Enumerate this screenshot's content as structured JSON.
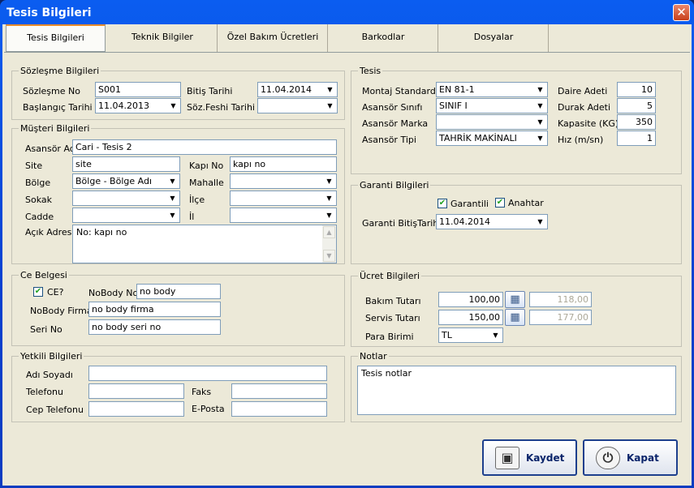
{
  "window": {
    "title": "Tesis Bilgileri",
    "close_glyph": "✕"
  },
  "tabs": [
    "Tesis Bilgileri",
    "Teknik Bilgiler",
    "Özel Bakım Ücretleri",
    "Barkodlar",
    "Dosyalar"
  ],
  "sozlesme": {
    "title": "Sözleşme Bilgileri",
    "no_label": "Sözleşme No",
    "no_value": "S001",
    "baslangic_label": "Başlangıç Tarihi",
    "baslangic_value": "11.04.2013",
    "bitis_label": "Bitiş Tarihi",
    "bitis_value": "11.04.2014",
    "fesih_label": "Söz.Feshi Tarihi",
    "fesih_value": ""
  },
  "musteri": {
    "title": "Müşteri Bilgileri",
    "asansor_adi_label": "Asansör Adı",
    "asansor_adi_value": "Cari - Tesis 2",
    "site_label": "Site",
    "site_value": "site",
    "kapi_label": "Kapı No",
    "kapi_value": "kapı no",
    "bolge_label": "Bölge",
    "bolge_value": "Bölge - Bölge Adı",
    "mahalle_label": "Mahalle",
    "mahalle_value": "",
    "sokak_label": "Sokak",
    "sokak_value": "",
    "ilce_label": "İlçe",
    "ilce_value": "",
    "cadde_label": "Cadde",
    "cadde_value": "",
    "il_label": "İl",
    "il_value": "",
    "acik_label": "Açık Adres",
    "acik_value": "No: kapı no"
  },
  "ce": {
    "title": "Ce Belgesi",
    "ce_label": "CE?",
    "ce_checked": true,
    "nobody_no_label": "NoBody No",
    "nobody_no_value": "no body",
    "nobody_firma_label": "NoBody Firma",
    "nobody_firma_value": "no body firma",
    "seri_label": "Seri No",
    "seri_value": "no body seri no"
  },
  "yetkili": {
    "title": "Yetkili Bilgileri",
    "ad_label": "Adı Soyadı",
    "ad_value": "",
    "tel_label": "Telefonu",
    "tel_value": "",
    "faks_label": "Faks",
    "faks_value": "",
    "cep_label": "Cep Telefonu",
    "cep_value": "",
    "eposta_label": "E-Posta",
    "eposta_value": ""
  },
  "tesis": {
    "title": "Tesis",
    "montaj_label": "Montaj Standardı",
    "montaj_value": "EN 81-1",
    "sinif_label": "Asansör Sınıfı",
    "sinif_value": "SINIF I",
    "marka_label": "Asansör Marka",
    "marka_value": "",
    "tip_label": "Asansör Tipi",
    "tip_value": "TAHRİK MAKİNALI",
    "daire_label": "Daire Adeti",
    "daire_value": "10",
    "durak_label": "Durak Adeti",
    "durak_value": "5",
    "kapasite_label": "Kapasite (KG)",
    "kapasite_value": "350",
    "hiz_label": "Hız (m/sn)",
    "hiz_value": "1"
  },
  "garanti": {
    "title": "Garanti Bilgileri",
    "garantili_label": "Garantili",
    "garantili_checked": true,
    "anahtar_label": "Anahtar",
    "anahtar_checked": true,
    "bitis_label": "Garanti BitişTarihi",
    "bitis_value": "11.04.2014"
  },
  "ucret": {
    "title": "Ücret Bilgileri",
    "bakim_label": "Bakım Tutarı",
    "bakim_value": "100,00",
    "bakim_kdv": "118,00",
    "servis_label": "Servis Tutarı",
    "servis_value": "150,00",
    "servis_kdv": "177,00",
    "para_label": "Para Birimi",
    "para_value": "TL"
  },
  "notlar": {
    "title": "Notlar",
    "value": "Tesis notlar"
  },
  "buttons": {
    "kaydet": "Kaydet",
    "kapat": "Kapat"
  },
  "icons": {
    "dropdown": "▼",
    "check": "✔",
    "calculator": "▦",
    "save": "▣",
    "power": "⏻",
    "scroll_up": "▲",
    "scroll_down": "▼"
  }
}
